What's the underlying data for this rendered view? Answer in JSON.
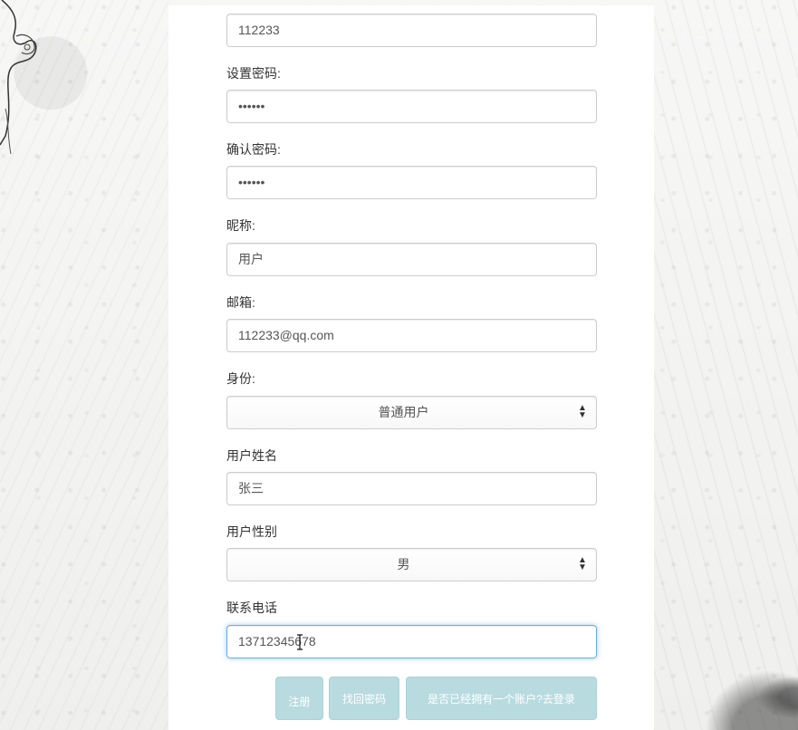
{
  "form": {
    "account_value": "112233",
    "password_label": "设置密码:",
    "password_value": "••••••",
    "confirm_label": "确认密码:",
    "confirm_value": "••••••",
    "nickname_label": "昵称:",
    "nickname_value": "用户",
    "email_label": "邮箱:",
    "email_value": "112233@qq.com",
    "role_label": "身份:",
    "role_value": "普通用户",
    "realname_label": "用户姓名",
    "realname_value": "张三",
    "gender_label": "用户性别",
    "gender_value": "男",
    "phone_label": "联系电话",
    "phone_value": "13712345678"
  },
  "buttons": {
    "register": "注册",
    "recover": "找回密码",
    "login": "是否已经拥有一个账户?去登录"
  },
  "icons": {
    "select_caret": "caret-up-down-icon",
    "text_cursor": "i-beam-cursor-icon"
  },
  "colors": {
    "button_bg": "#b8dbe0",
    "focus_border": "#66afe9"
  }
}
